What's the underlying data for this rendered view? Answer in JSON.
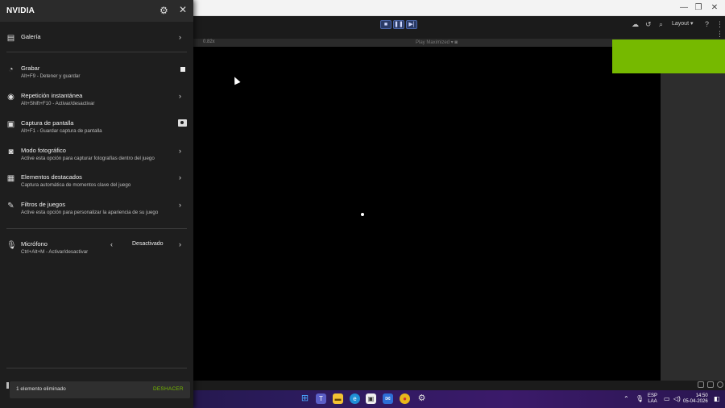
{
  "overlay": {
    "brand": "NVIDIA",
    "items": [
      {
        "title": "Galería",
        "subtitle": ""
      },
      {
        "title": "Grabar",
        "subtitle": "Alt+F9 - Detener y guardar"
      },
      {
        "title": "Repetición instantánea",
        "subtitle": "Alt+Shift+F10 - Activar/desactivar"
      },
      {
        "title": "Captura de pantalla",
        "subtitle": "Alt+F1 - Guardar captura de pantalla"
      },
      {
        "title": "Modo fotográfico",
        "subtitle": "Active esta opción para capturar fotografías dentro del juego"
      },
      {
        "title": "Elementos destacados",
        "subtitle": "Captura automática de momentos clave del juego"
      },
      {
        "title": "Filtros de juegos",
        "subtitle": "Active esta opción para personalizar la apariencia de su juego"
      },
      {
        "title": "Micrófono",
        "subtitle": "Ctrl+Alt+M - Activar/desactivar",
        "status": "Desactivado"
      }
    ],
    "toast": {
      "message": "1 elemento eliminado",
      "action": "DESHACER"
    }
  },
  "app": {
    "zoom": "0.82x",
    "play_label": "Play Maximized",
    "layout_label": "Layout"
  },
  "taskbar": {
    "lang": "ESP",
    "lang_sub": "LAA",
    "time": "14:50",
    "date": "05-04-2026"
  },
  "colors": {
    "accent": "#76b900",
    "panel_bg": "#1e1e1e"
  }
}
